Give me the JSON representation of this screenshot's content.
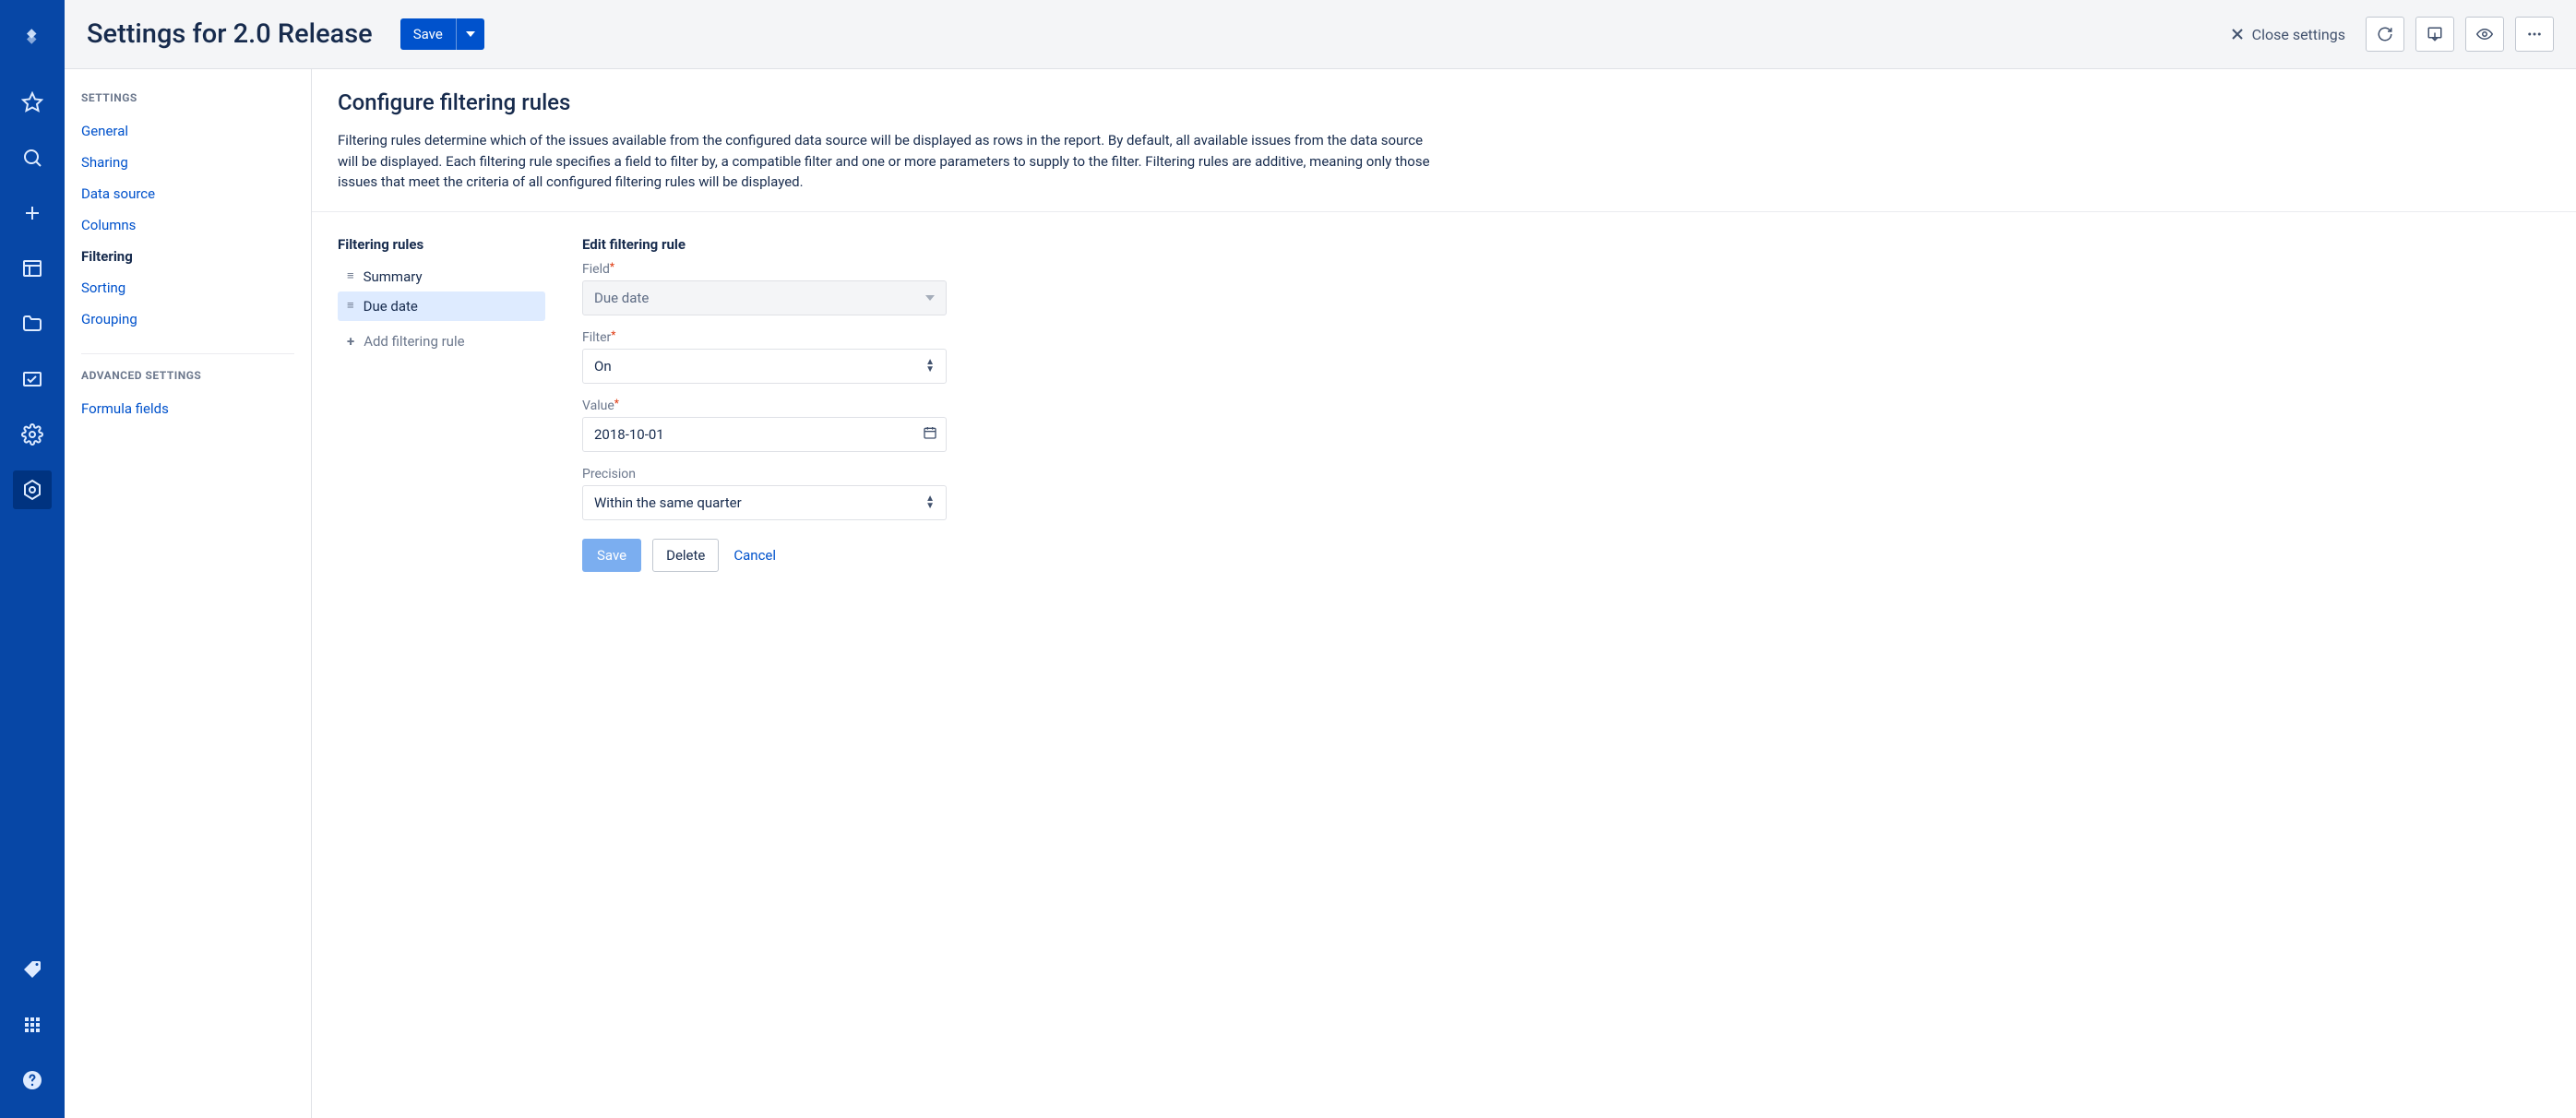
{
  "header": {
    "title": "Settings for 2.0 Release",
    "save_label": "Save",
    "close_label": "Close settings"
  },
  "sidebar": {
    "section1_label": "SETTINGS",
    "section2_label": "ADVANCED SETTINGS",
    "items1": [
      "General",
      "Sharing",
      "Data source",
      "Columns",
      "Filtering",
      "Sorting",
      "Grouping"
    ],
    "active_item": "Filtering",
    "items2": [
      "Formula fields"
    ]
  },
  "panel": {
    "heading": "Configure filtering rules",
    "description": "Filtering rules determine which of the issues available from the configured data source will be displayed as rows in the report. By default, all available issues from the data source will be displayed. Each filtering rule specifies a field to filter by, a compatible filter and one or more parameters to supply to the filter. Filtering rules are additive, meaning only those issues that meet the criteria of all configured filtering rules will be displayed.",
    "rules_heading": "Filtering rules",
    "rules": [
      "Summary",
      "Due date"
    ],
    "selected_rule": "Due date",
    "add_rule_label": "Add filtering rule",
    "edit_heading": "Edit filtering rule",
    "form": {
      "field_label": "Field",
      "field_value": "Due date",
      "filter_label": "Filter",
      "filter_value": "On",
      "value_label": "Value",
      "value_value": "2018-10-01",
      "precision_label": "Precision",
      "precision_value": "Within the same quarter",
      "save_label": "Save",
      "delete_label": "Delete",
      "cancel_label": "Cancel"
    }
  }
}
